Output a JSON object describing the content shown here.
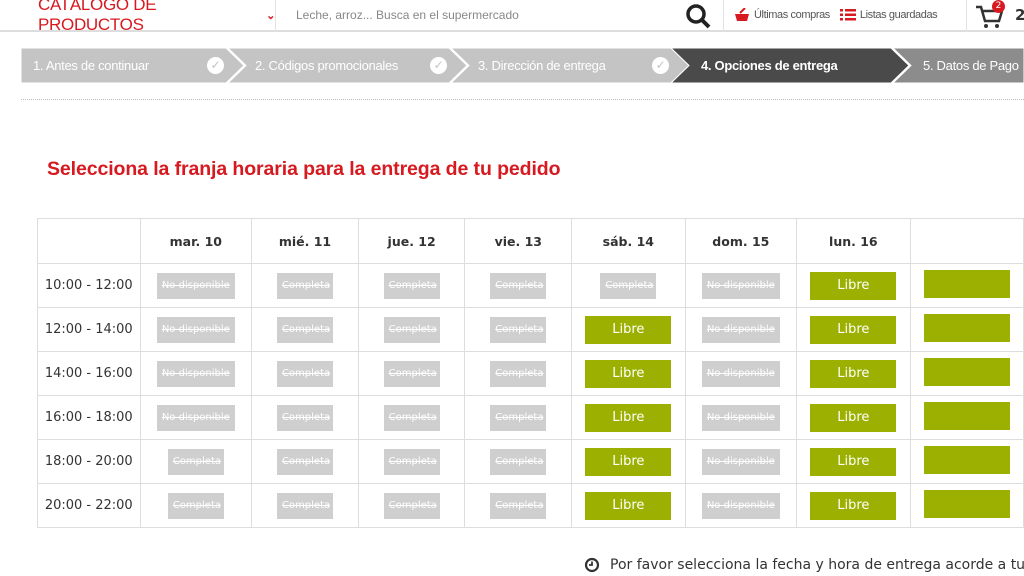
{
  "header": {
    "catalog_label": "CATÁLOGO DE PRODUCTOS",
    "search_placeholder": "Leche, arroz... Busca en el supermercado",
    "last_purchases": "Últimas compras",
    "saved_lists": "Listas guardadas",
    "cart_badge": "2",
    "cart_count": "2",
    "brand_color": "#d71920"
  },
  "steps": [
    {
      "label": "1. Antes de continuar",
      "state": "done"
    },
    {
      "label": "2. Códigos promocionales",
      "state": "done"
    },
    {
      "label": "3. Dirección de entrega",
      "state": "done"
    },
    {
      "label": "4. Opciones de entrega",
      "state": "active"
    },
    {
      "label": "5. Datos de Pago",
      "state": "pending"
    }
  ],
  "title": "Selecciona la franja horaria para la entrega de tu pedido",
  "schedule": {
    "days": [
      "mar. 10",
      "mié. 11",
      "jue. 12",
      "vie. 13",
      "sáb. 14",
      "dom. 15",
      "lun. 16",
      ""
    ],
    "status_labels": {
      "N": "No disponible",
      "C": "Completa",
      "L": "Libre"
    },
    "rows": [
      {
        "time": "10:00 - 12:00",
        "slots": [
          "N",
          "C",
          "C",
          "C",
          "C",
          "N",
          "L",
          "L"
        ]
      },
      {
        "time": "12:00 - 14:00",
        "slots": [
          "N",
          "C",
          "C",
          "C",
          "L",
          "N",
          "L",
          "L"
        ]
      },
      {
        "time": "14:00 - 16:00",
        "slots": [
          "N",
          "C",
          "C",
          "C",
          "L",
          "N",
          "L",
          "L"
        ]
      },
      {
        "time": "16:00 - 18:00",
        "slots": [
          "N",
          "C",
          "C",
          "C",
          "L",
          "N",
          "L",
          "L"
        ]
      },
      {
        "time": "18:00 - 20:00",
        "slots": [
          "C",
          "C",
          "C",
          "C",
          "L",
          "N",
          "L",
          "L"
        ]
      },
      {
        "time": "20:00 - 22:00",
        "slots": [
          "C",
          "C",
          "C",
          "C",
          "L",
          "N",
          "L",
          "L"
        ]
      }
    ],
    "free_color": "#9bb000",
    "unavailable_color": "#cfcfcf"
  },
  "note": "Por favor selecciona la fecha y hora de entrega acorde a tus"
}
